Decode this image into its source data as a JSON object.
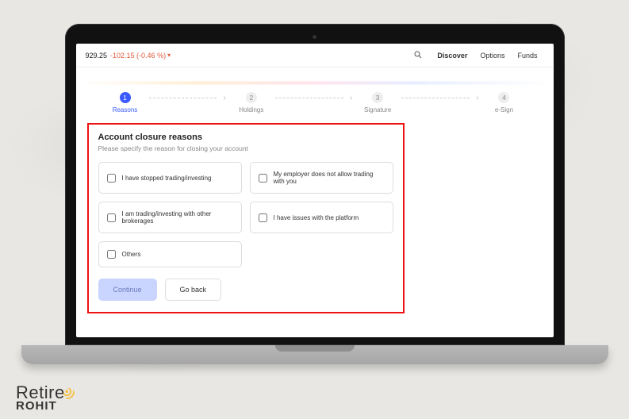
{
  "topbar": {
    "ticker_value": "929.25",
    "ticker_change": "-102.15 (-0.46 %)",
    "nav": {
      "discover": "Discover",
      "options": "Options",
      "funds": "Funds"
    }
  },
  "stepper": {
    "steps": [
      {
        "num": "1",
        "label": "Reasons"
      },
      {
        "num": "2",
        "label": "Holdings"
      },
      {
        "num": "3",
        "label": "Signature"
      },
      {
        "num": "4",
        "label": "e-Sign"
      }
    ]
  },
  "panel": {
    "title": "Account closure reasons",
    "subtitle": "Please specify the reason for closing your account",
    "options": [
      "I have stopped trading/investing",
      "My employer does not allow trading with you",
      "I am trading/investing with other brokerages",
      "I have issues with the platform",
      "Others"
    ],
    "continue": "Continue",
    "goback": "Go back"
  },
  "watermark": {
    "line1": "Retire",
    "line2": "ROHIT"
  }
}
